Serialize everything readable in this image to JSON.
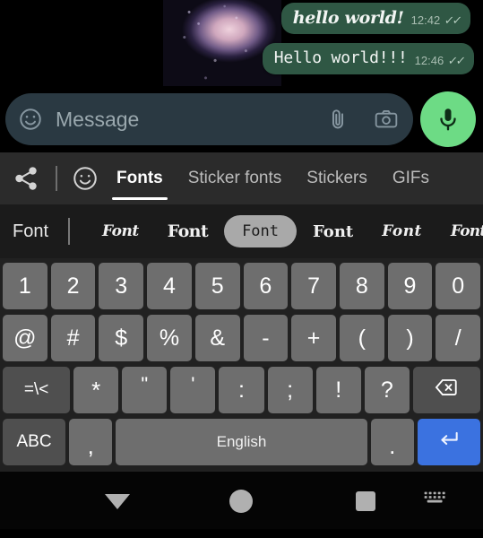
{
  "chat": {
    "messages": [
      {
        "text": "hello world!",
        "time": "12:42",
        "status": "read-ticks",
        "font": "gothic"
      },
      {
        "text": "Hello world!!!",
        "time": "12:46",
        "status": "read-ticks",
        "font": "monospace"
      }
    ],
    "attachment_icon": "photo-thumbnail"
  },
  "input_bar": {
    "emoji_icon": "smiley-icon",
    "placeholder": "Message",
    "value": "",
    "attach_icon": "paperclip-icon",
    "camera_icon": "camera-icon",
    "mic_icon": "microphone-icon",
    "mic_color": "#6ddb85",
    "pill_color": "#2a3942"
  },
  "tab_bar": {
    "share_icon": "share-icon",
    "smiley_icon": "smiley-outline-icon",
    "tabs": [
      {
        "label": "Fonts",
        "active": true
      },
      {
        "label": "Sticker fonts",
        "active": false
      },
      {
        "label": "Stickers",
        "active": false
      },
      {
        "label": "GIFs",
        "active": false
      }
    ]
  },
  "fonts_row": {
    "label": "Font",
    "chips": [
      {
        "text": "Font",
        "style": "gothic-light",
        "selected": false
      },
      {
        "text": "Font",
        "style": "gothic-bold",
        "selected": false
      },
      {
        "text": "Font",
        "style": "typewriter",
        "selected": true
      },
      {
        "text": "Font",
        "style": "blackletter-outline",
        "selected": false
      },
      {
        "text": "Font",
        "style": "script-wide",
        "selected": false
      },
      {
        "text": "Font",
        "style": "script-tight",
        "selected": false
      },
      {
        "text": "F",
        "style": "script-cut",
        "selected": false
      }
    ]
  },
  "keyboard": {
    "rows": [
      {
        "name": "numbers",
        "keys": [
          {
            "label": "1"
          },
          {
            "label": "2"
          },
          {
            "label": "3"
          },
          {
            "label": "4"
          },
          {
            "label": "5"
          },
          {
            "label": "6"
          },
          {
            "label": "7"
          },
          {
            "label": "8"
          },
          {
            "label": "9"
          },
          {
            "label": "0"
          }
        ]
      },
      {
        "name": "symbols",
        "keys": [
          {
            "label": "@"
          },
          {
            "label": "#"
          },
          {
            "label": "$"
          },
          {
            "label": "%"
          },
          {
            "label": "&"
          },
          {
            "label": "-"
          },
          {
            "label": "+"
          },
          {
            "label": "("
          },
          {
            "label": ")"
          },
          {
            "label": "/"
          }
        ]
      },
      {
        "name": "punctuation",
        "keys": [
          {
            "label": "=\\<"
          },
          {
            "label": "*"
          },
          {
            "label": "\""
          },
          {
            "label": "'"
          },
          {
            "label": ":"
          },
          {
            "label": ";"
          },
          {
            "label": "!"
          },
          {
            "label": "?"
          },
          {
            "label": "",
            "icon": "backspace-icon"
          }
        ]
      },
      {
        "name": "bottom",
        "keys": [
          {
            "label": "ABC"
          },
          {
            "label": ","
          },
          {
            "label": "English"
          },
          {
            "label": "."
          },
          {
            "label": "",
            "icon": "enter-icon"
          }
        ]
      }
    ],
    "key_color": "#6e6e6e",
    "dark_key_color": "#4f4f4f",
    "enter_color": "#3b72e0",
    "background": "#212121",
    "space_label": "English"
  },
  "nav_bar": {
    "items": [
      {
        "name": "back",
        "icon": "triangle-down-icon"
      },
      {
        "name": "home",
        "icon": "circle-icon"
      },
      {
        "name": "recents",
        "icon": "square-icon"
      },
      {
        "name": "keyboard-switch",
        "icon": "keyboard-icon"
      }
    ]
  }
}
